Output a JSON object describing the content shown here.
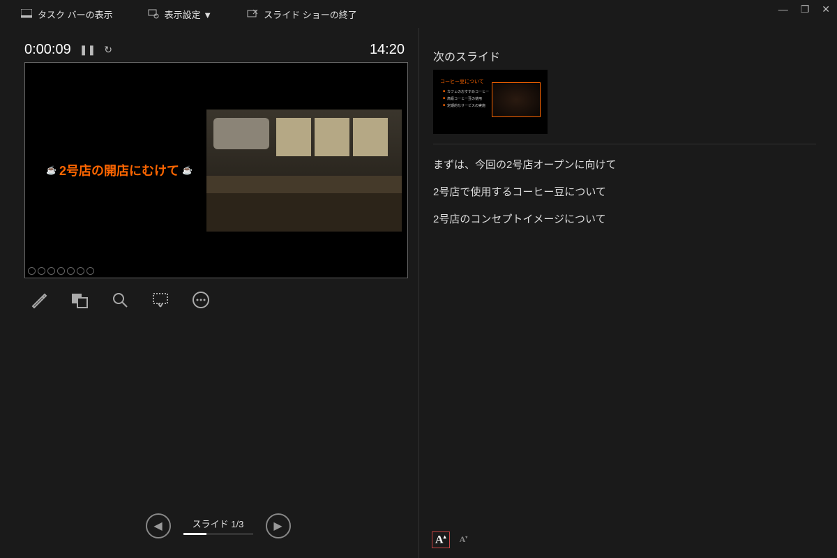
{
  "topbar": {
    "taskbar": "タスク バーの表示",
    "display_settings": "表示設定 ▼",
    "end_show": "スライド ショーの終了"
  },
  "timer": {
    "elapsed": "0:00:09",
    "clock": "14:20"
  },
  "current_slide": {
    "title": "2号店の開店にむけて"
  },
  "next": {
    "label": "次のスライド",
    "thumb_title": "コーヒー豆について",
    "bullets": [
      "カフェのおすすめコーヒー",
      "高級コーヒー豆の使用",
      "定期的なサービスの実施"
    ]
  },
  "notes": [
    "まずは、今回の2号店オープンに向けて",
    "2号店で使用するコーヒー豆について",
    "2号店のコンセプトイメージについて"
  ],
  "navigation": {
    "label": "スライド 1/3"
  },
  "icons": {
    "taskbar": "taskbar-icon",
    "display": "display-settings-icon",
    "end": "end-show-icon"
  }
}
